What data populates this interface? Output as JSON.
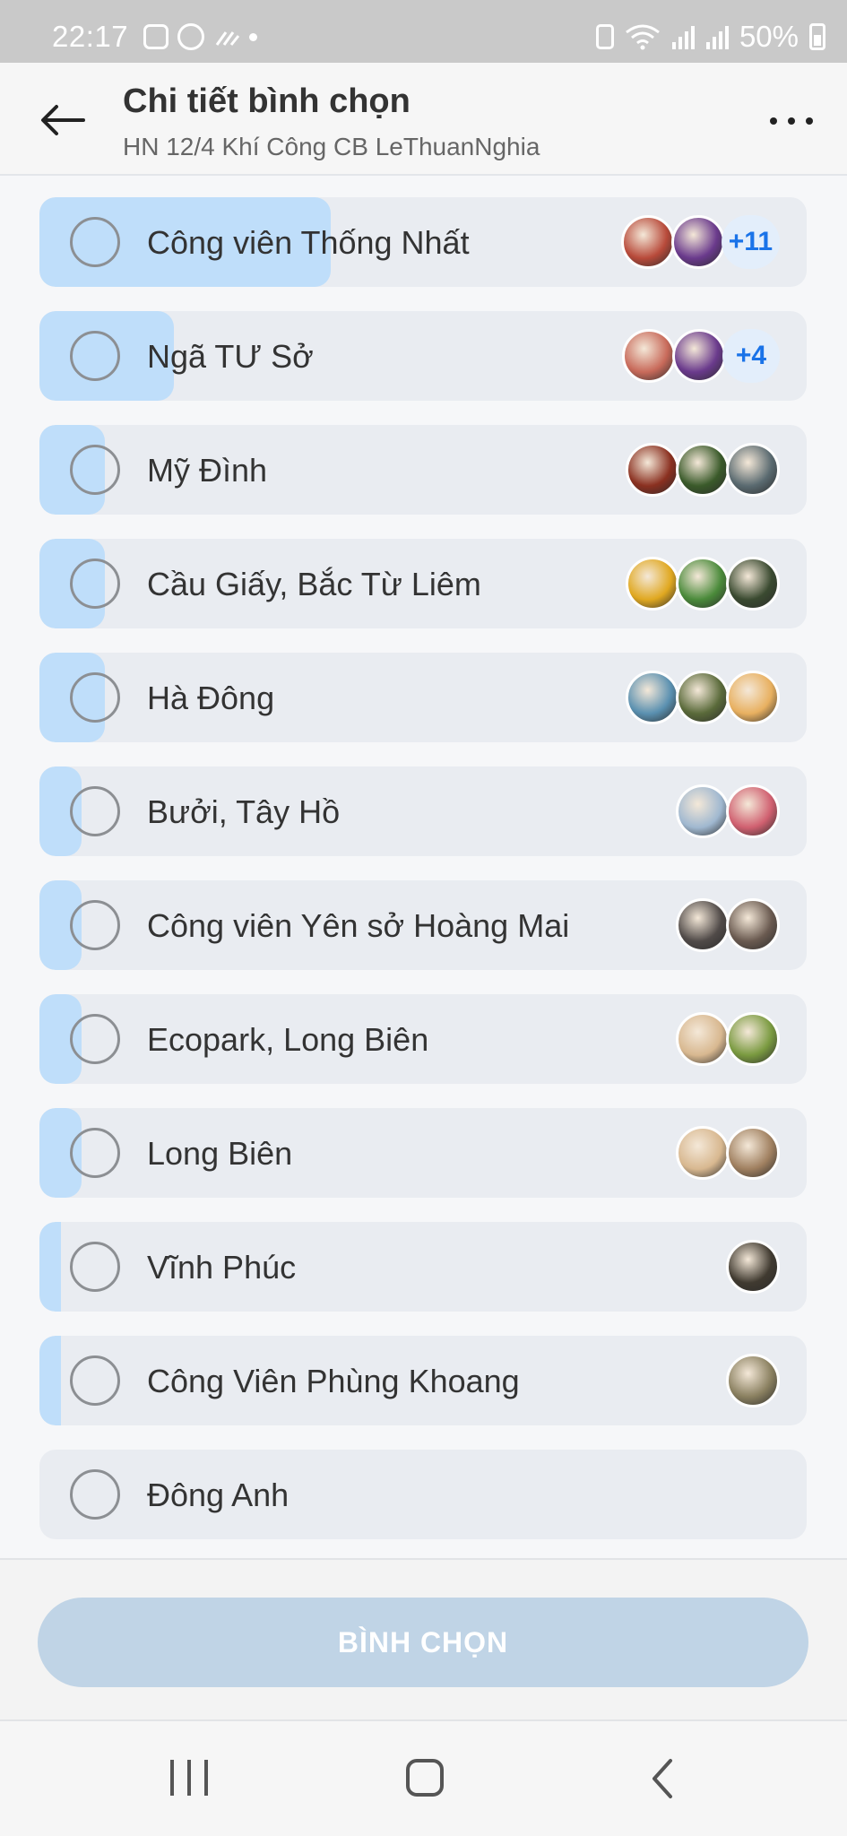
{
  "status_bar": {
    "time": "22:17",
    "battery": "50%",
    "icons_left": [
      "picture-icon",
      "viber-icon",
      "signal-lines-icon",
      "dot-icon"
    ],
    "icons_right": [
      "battery-saver-icon",
      "wifi-icon",
      "signal-icon",
      "signal-icon",
      "battery-icon"
    ]
  },
  "header": {
    "title": "Chi tiết bình chọn",
    "subtitle": "HN 12/4 Khí Công CB LeThuanNghia"
  },
  "options": [
    {
      "label": "Công viên Thống Nhất",
      "fill": 0.38,
      "avatars": [
        "#b84a3a",
        "#6a3a8c"
      ],
      "more": "+11"
    },
    {
      "label": "Ngã TƯ Sở",
      "fill": 0.175,
      "avatars": [
        "#c86a5a",
        "#6a3a8c"
      ],
      "more": "+4"
    },
    {
      "label": "Mỹ Đình",
      "fill": 0.085,
      "avatars": [
        "#8a3020",
        "#3a5a2a",
        "#5a6a70"
      ],
      "more": ""
    },
    {
      "label": "Cầu Giấy, Bắc Từ Liêm",
      "fill": 0.085,
      "avatars": [
        "#e0a820",
        "#4a8a3a",
        "#3a4a30"
      ],
      "more": ""
    },
    {
      "label": "Hà Đông",
      "fill": 0.085,
      "avatars": [
        "#5a90b0",
        "#5a6a3a",
        "#e8b060"
      ],
      "more": ""
    },
    {
      "label": "Bưởi, Tây Hồ",
      "fill": 0.055,
      "avatars": [
        "#a0b8d0",
        "#d06070"
      ],
      "more": ""
    },
    {
      "label": "Công viên Yên sở Hoàng Mai",
      "fill": 0.055,
      "avatars": [
        "#504a48",
        "#6a5a50"
      ],
      "more": ""
    },
    {
      "label": "Ecopark, Long Biên",
      "fill": 0.055,
      "avatars": [
        "#d8b890",
        "#7a9a40"
      ],
      "more": ""
    },
    {
      "label": "Long Biên",
      "fill": 0.055,
      "avatars": [
        "#d8b890",
        "#a08060"
      ],
      "more": ""
    },
    {
      "label": "Vĩnh Phúc",
      "fill": 0.028,
      "avatars": [
        "#403a30"
      ],
      "more": ""
    },
    {
      "label": "Công Viên Phùng Khoang",
      "fill": 0.028,
      "avatars": [
        "#8a8060"
      ],
      "more": ""
    },
    {
      "label": "Đông Anh",
      "fill": 0,
      "avatars": [],
      "more": ""
    }
  ],
  "footer": {
    "vote_label": "BÌNH CHỌN"
  }
}
